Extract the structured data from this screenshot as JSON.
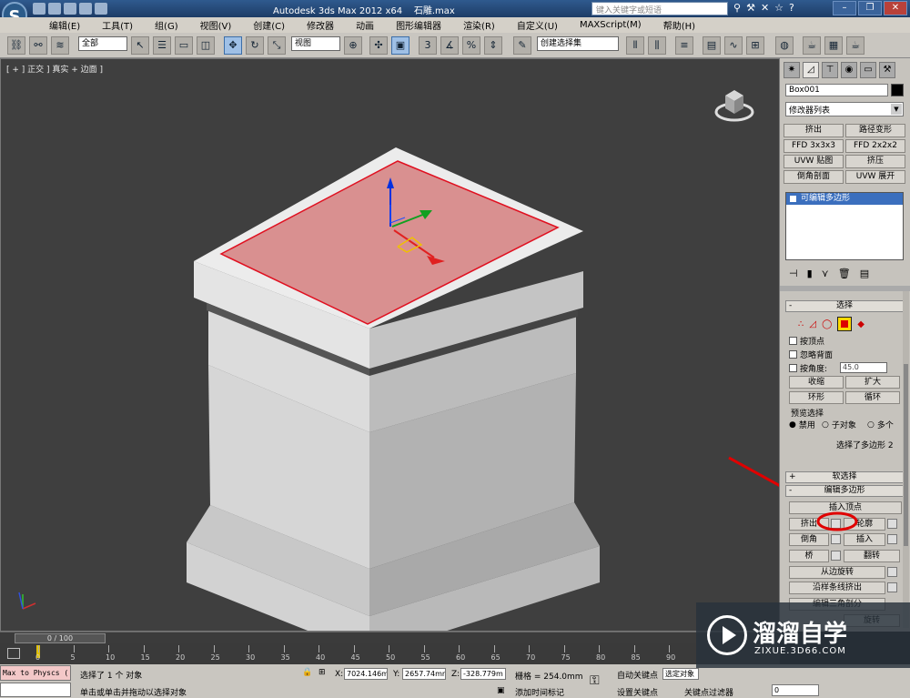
{
  "title": {
    "app": "Autodesk 3ds Max  2012 x64",
    "file": "石雕.max",
    "search_placeholder": "键入关键字或短语"
  },
  "menu": [
    "编辑(E)",
    "工具(T)",
    "组(G)",
    "视图(V)",
    "创建(C)",
    "修改器",
    "动画",
    "图形编辑器",
    "渲染(R)",
    "自定义(U)",
    "MAXScript(M)",
    "帮助(H)"
  ],
  "toolbar": {
    "selection_filter": "全部",
    "coord_system": "视图",
    "named_selection": "创建选择集"
  },
  "viewport": {
    "label": "[ + ] 正交 ] 真实 + 边面 ]"
  },
  "command_panel": {
    "object_name": "Box001",
    "object_color": "#000000",
    "modifier_list": "修改器列表",
    "modifier_buttons": [
      "挤出",
      "路径变形",
      "FFD 3x3x3",
      "FFD 2x2x2",
      "UVW 贴图",
      "挤压",
      "倒角剖面",
      "UVW 展开"
    ],
    "stack_item": "可编辑多边形",
    "selection": {
      "title": "选择",
      "by_vertex": "按顶点",
      "ignore_backfacing": "忽略背面",
      "by_angle": "按角度:",
      "angle_value": "45.0",
      "shrink": "收缩",
      "grow": "扩大",
      "ring": "环形",
      "loop": "循环",
      "preview_title": "预览选择",
      "preview_off": "禁用",
      "preview_subobj": "子对象",
      "preview_multi": "多个",
      "status": "选择了多边形 2"
    },
    "soft_selection": "软选择",
    "edit_polygons": {
      "title": "编辑多边形",
      "insert_vertex": "插入顶点",
      "extrude": "挤出",
      "outline": "轮廓",
      "bevel": "倒角",
      "inset": "插入",
      "bridge": "桥",
      "flip": "翻转",
      "hinge": "从边旋转",
      "extrude_along_spline": "沿样条线挤出",
      "edit_triangulation": "编辑三角剖分",
      "retriangulate": "旋转"
    }
  },
  "timeline": {
    "frame": "0 / 100",
    "ticks": [
      "0",
      "5",
      "10",
      "15",
      "20",
      "25",
      "30",
      "35",
      "40",
      "45",
      "50",
      "55",
      "60",
      "65",
      "70",
      "75",
      "80",
      "85",
      "90"
    ]
  },
  "status": {
    "maxscript_line1": "Max to Physcs (",
    "maxscript_line2": "",
    "selected": "选择了 1 个 对象",
    "prompt": "单击或单击并拖动以选择对象",
    "x_label": "X:",
    "x": "7024.146m",
    "y_label": "Y:",
    "y": "2657.74mr",
    "z_label": "Z:",
    "z": "-328.779m",
    "grid": "栅格 = 254.0mm",
    "add_time_tag": "添加时间标记",
    "auto_key": "自动关键点",
    "selected_object": "选定对象",
    "set_key": "设置关键点",
    "key_filters": "关键点过滤器",
    "frame_field": "0"
  },
  "watermark": {
    "name": "溜溜自学",
    "url": "ZIXUE.3D66.COM"
  },
  "colors": {
    "selected_face": "#d99090",
    "annotation": "#e00000"
  }
}
